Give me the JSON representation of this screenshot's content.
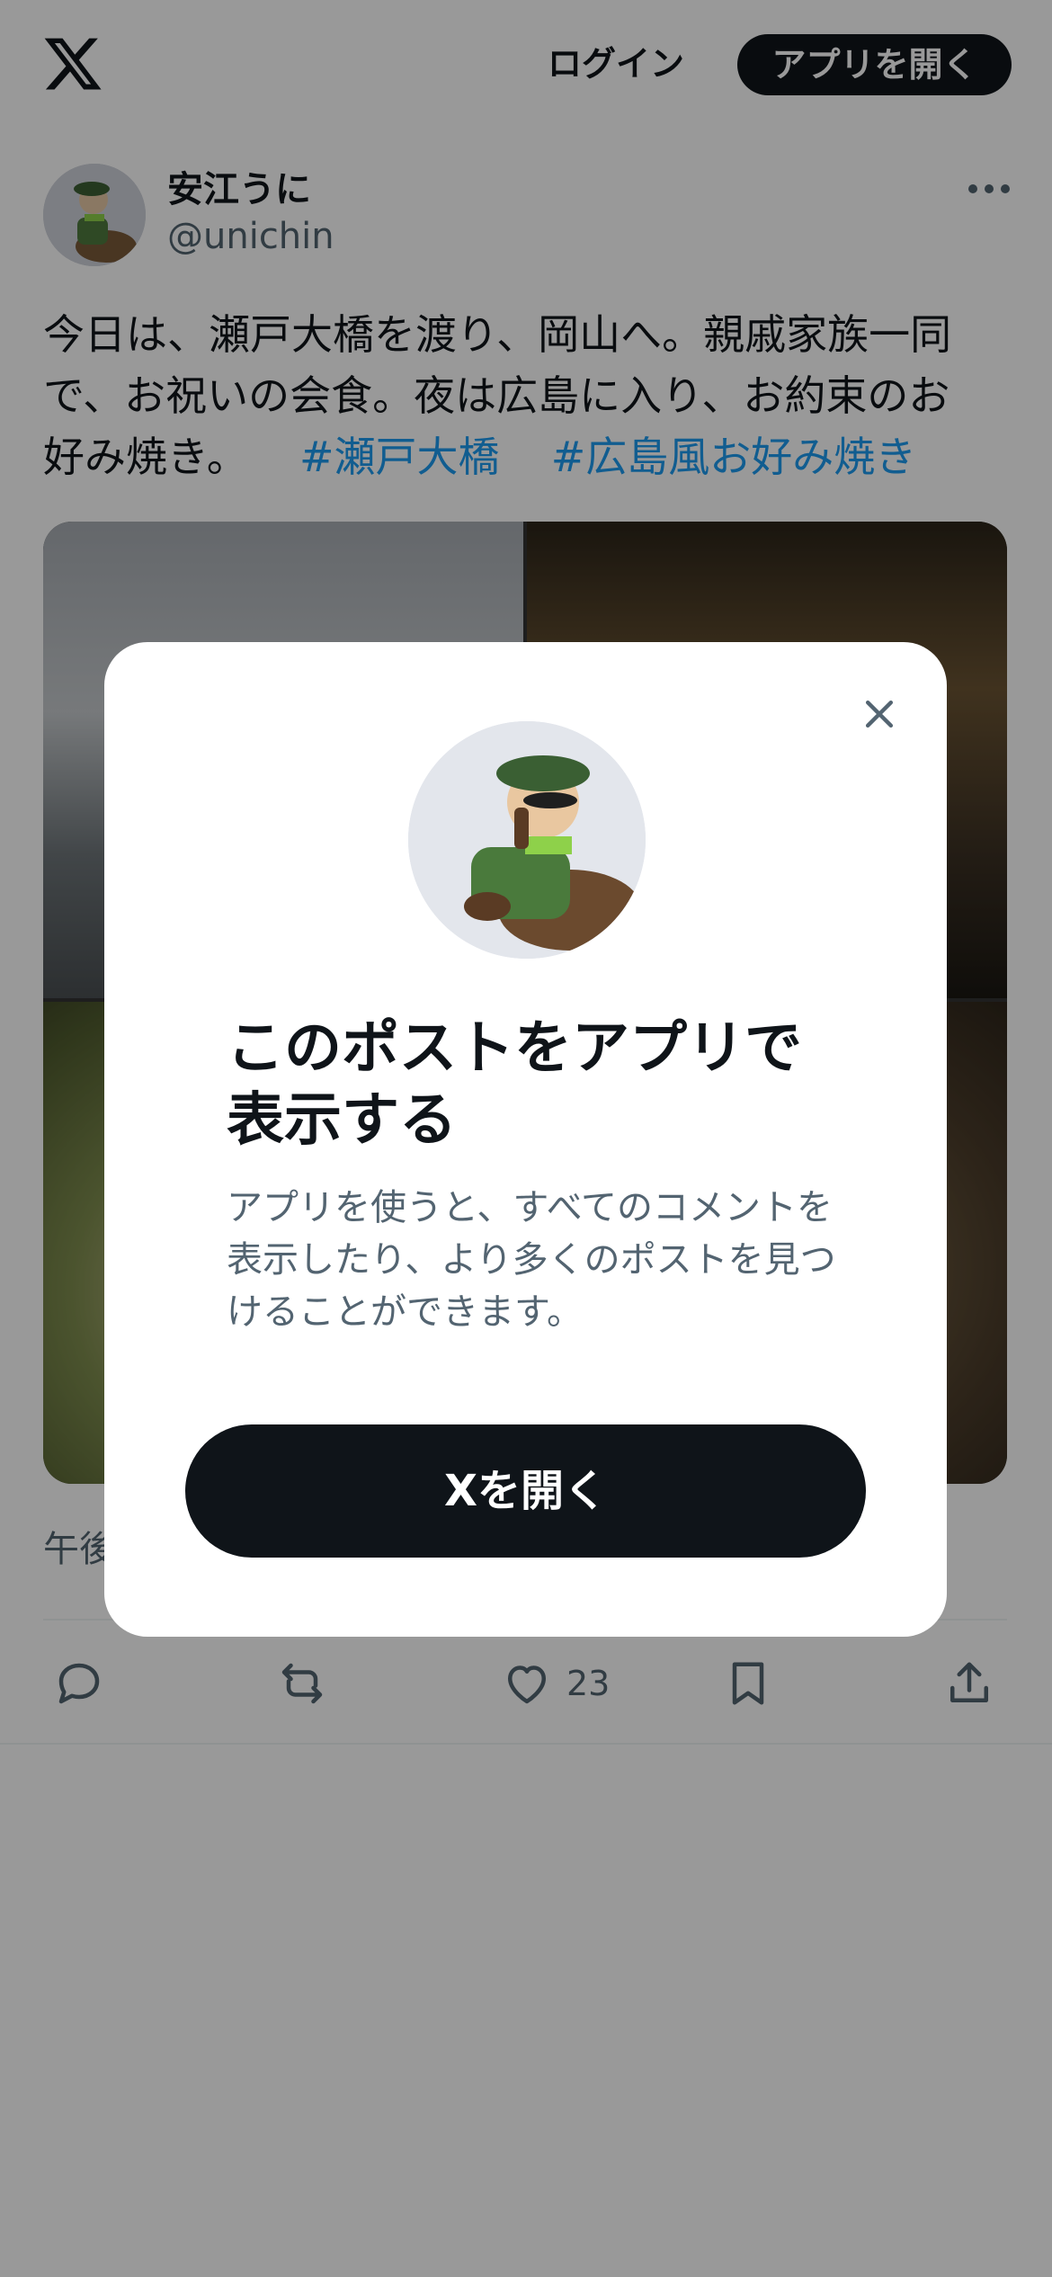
{
  "header": {
    "logo_icon": "x-logo-icon",
    "login_label": "ログイン",
    "open_app_label": "アプリを開く"
  },
  "post": {
    "author_name": "安江うに",
    "author_handle": "@unichin",
    "text_line1": "今日は、瀬戸大橋を渡り、岡山へ。親戚家族一同",
    "text_line2": "で、お祝いの会食。夜は広島に入り、お約束のお",
    "text_line3_prefix": "好み焼き。",
    "hashtags": [
      "#瀬戸大橋",
      "#広島風お好み焼き"
    ],
    "time_partial": "午後",
    "like_count": "23"
  },
  "modal": {
    "title": "このポストをアプリで表示する",
    "description": "アプリを使うと、すべてのコメントを表示したり、より多くのポストを見つけることができます。",
    "cta_label": "Xを開く",
    "accent": "#1d9bf0"
  }
}
